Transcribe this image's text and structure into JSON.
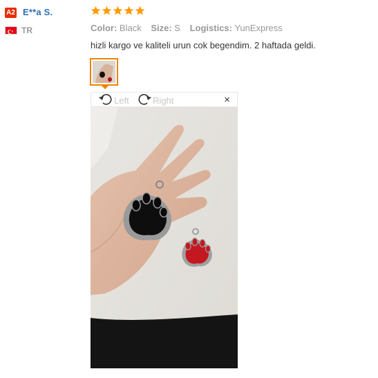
{
  "reviewer": {
    "level_badge": "A2",
    "name": "E**a S.",
    "country_code": "TR",
    "flag_icon": "turkey-flag-icon"
  },
  "rating": {
    "stars": 5,
    "max": 5,
    "color": "#ff9a00"
  },
  "attributes": {
    "color_label": "Color:",
    "color_value": "Black",
    "size_label": "Size:",
    "size_value": "S",
    "logistics_label": "Logistics:",
    "logistics_value": "YunExpress"
  },
  "review_text": "hizli kargo ve kaliteli urun cok begendim. 2 haftada geldi.",
  "image_viewer": {
    "rotate_left_label": "Left",
    "rotate_right_label": "Right",
    "close_label": "×"
  },
  "colors": {
    "badge": "#e62e04",
    "name": "#2e6fb5",
    "accent": "#f08200"
  }
}
